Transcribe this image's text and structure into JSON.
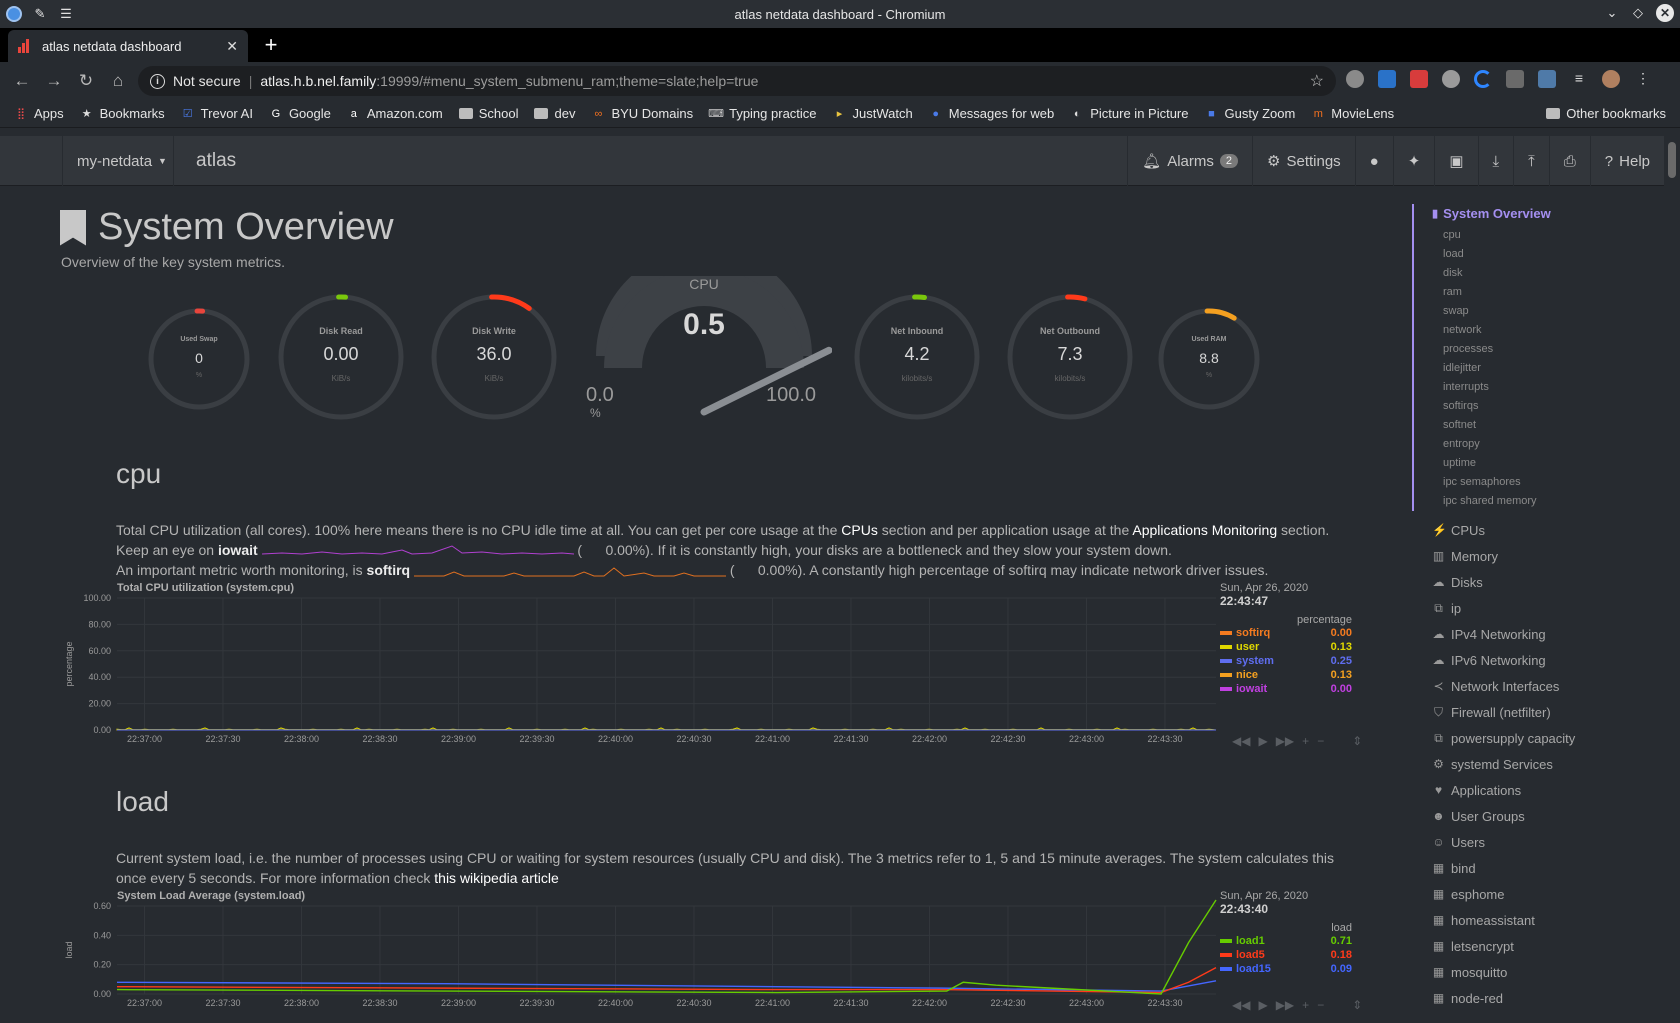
{
  "window": {
    "title": "atlas netdata dashboard - Chromium"
  },
  "tab": {
    "title": "atlas netdata dashboard"
  },
  "omnibox": {
    "security": "Not secure",
    "host": "atlas.h.b.nel.family",
    "path": ":19999/#menu_system_submenu_ram;theme=slate;help=true"
  },
  "bookmarks": [
    {
      "label": "Apps",
      "icon": "apps-grid-icon"
    },
    {
      "label": "Bookmarks",
      "icon": "star-icon"
    },
    {
      "label": "Trevor AI",
      "icon": "check-square-icon"
    },
    {
      "label": "Google",
      "icon": "google-icon"
    },
    {
      "label": "Amazon.com",
      "icon": "amazon-icon"
    },
    {
      "label": "School",
      "icon": "folder-icon"
    },
    {
      "label": "dev",
      "icon": "folder-icon"
    },
    {
      "label": "BYU Domains",
      "icon": "link-icon"
    },
    {
      "label": "Typing practice",
      "icon": "keyboard-icon"
    },
    {
      "label": "JustWatch",
      "icon": "play-icon"
    },
    {
      "label": "Messages for web",
      "icon": "chat-icon"
    },
    {
      "label": "Picture in Picture",
      "icon": "pip-icon"
    },
    {
      "label": "Gusty Zoom",
      "icon": "video-icon"
    },
    {
      "label": "MovieLens",
      "icon": "m-icon"
    }
  ],
  "other_bookmarks": "Other bookmarks",
  "nav": {
    "brand": "my-netdata",
    "host": "atlas",
    "alarms": "Alarms",
    "alarm_count": "2",
    "settings": "Settings",
    "help": "Help"
  },
  "overview": {
    "title": "System Overview",
    "subtitle": "Overview of the key system metrics."
  },
  "gauges": {
    "used_swap": {
      "label": "Used Swap",
      "value": "0",
      "unit": "%",
      "fraction": 0.0
    },
    "disk_read": {
      "label": "Disk Read",
      "value": "0.00",
      "unit": "KiB/s",
      "fraction": 0.0
    },
    "disk_write": {
      "label": "Disk Write",
      "value": "36.0",
      "unit": "KiB/s",
      "fraction": 0.1
    },
    "cpu": {
      "label": "CPU",
      "value": "0.5",
      "min": "0.0",
      "max": "100.0",
      "unit": "%",
      "fraction": 0.005
    },
    "net_inbound": {
      "label": "Net Inbound",
      "value": "4.2",
      "unit": "kilobits/s",
      "fraction": 0.02
    },
    "net_outbound": {
      "label": "Net Outbound",
      "value": "7.3",
      "unit": "kilobits/s",
      "fraction": 0.04
    },
    "used_ram": {
      "label": "Used RAM",
      "value": "8.8",
      "unit": "%",
      "fraction": 0.088
    }
  },
  "cpu_section": {
    "title": "cpu",
    "desc1_a": "Total CPU utilization (all cores). 100% here means there is no CPU idle time at all. You can get per core usage at the ",
    "desc1_link1": "CPUs",
    "desc1_b": " section and per application usage at the ",
    "desc1_link2": "Applications Monitoring",
    "desc1_c": " section.",
    "desc2_a": "Keep an eye on ",
    "desc2_bold": "iowait",
    "desc2_val": "0.00%",
    "desc2_b": ". If it is constantly high, your disks are a bottleneck and they slow your system down.",
    "desc3_a": "An important metric worth monitoring, is ",
    "desc3_bold": "softirq",
    "desc3_val": "0.00%",
    "desc3_b": ". A constantly high percentage of softirq may indicate network driver issues."
  },
  "load_section": {
    "title": "load",
    "desc_a": "Current system load, i.e. the number of processes using CPU or waiting for system resources (usually CPU and disk). The 3 metrics refer to 1, 5 and 15 minute averages. The system calculates this once every 5 seconds. For more information check ",
    "desc_link": "this wikipedia article"
  },
  "chart_data": [
    {
      "type": "area",
      "title": "Total CPU utilization (system.cpu)",
      "ylabel": "percentage",
      "ylim": [
        0,
        100
      ],
      "yticks": [
        "100.00",
        "80.00",
        "60.00",
        "40.00",
        "20.00",
        "0.00"
      ],
      "x": [
        "22:37:00",
        "22:37:30",
        "22:38:00",
        "22:38:30",
        "22:39:00",
        "22:39:30",
        "22:40:00",
        "22:40:30",
        "22:41:00",
        "22:41:30",
        "22:42:00",
        "22:42:30",
        "22:43:00",
        "22:43:30"
      ],
      "legend_date": "Sun, Apr 26, 2020",
      "legend_time": "22:43:47",
      "legend_units": "percentage",
      "series": [
        {
          "name": "softirq",
          "value": "0.00",
          "color": "#f47b20"
        },
        {
          "name": "user",
          "value": "0.13",
          "color": "#e0d800"
        },
        {
          "name": "system",
          "value": "0.25",
          "color": "#5f6ef0"
        },
        {
          "name": "nice",
          "value": "0.13",
          "color": "#f4a020"
        },
        {
          "name": "iowait",
          "value": "0.00",
          "color": "#c040e0"
        }
      ]
    },
    {
      "type": "line",
      "title": "System Load Average (system.load)",
      "ylabel": "load",
      "ylim": [
        0,
        0.6
      ],
      "yticks": [
        "0.60",
        "0.40",
        "0.20",
        "0.00"
      ],
      "x": [
        "22:37:00",
        "22:37:30",
        "22:38:00",
        "22:38:30",
        "22:39:00",
        "22:39:30",
        "22:40:00",
        "22:40:30",
        "22:41:00",
        "22:41:30",
        "22:42:00",
        "22:42:30",
        "22:43:00",
        "22:43:30"
      ],
      "legend_date": "Sun, Apr 26, 2020",
      "legend_time": "22:43:40",
      "legend_units": "load",
      "series": [
        {
          "name": "load1",
          "value": "0.71",
          "color": "#66cc00"
        },
        {
          "name": "load5",
          "value": "0.18",
          "color": "#ff3a1a"
        },
        {
          "name": "load15",
          "value": "0.09",
          "color": "#4466ff"
        }
      ]
    }
  ],
  "menu": {
    "active": "System Overview",
    "subitems": [
      "cpu",
      "load",
      "disk",
      "ram",
      "swap",
      "network",
      "processes",
      "idlejitter",
      "interrupts",
      "softirqs",
      "softnet",
      "entropy",
      "uptime",
      "ipc semaphores",
      "ipc shared memory"
    ],
    "items": [
      {
        "label": "CPUs",
        "icon": "bolt-icon",
        "glyph": "⚡"
      },
      {
        "label": "Memory",
        "icon": "memory-icon",
        "glyph": "▥"
      },
      {
        "label": "Disks",
        "icon": "hdd-icon",
        "glyph": "☁"
      },
      {
        "label": "ip",
        "icon": "sitemap-icon",
        "glyph": "⧉"
      },
      {
        "label": "IPv4 Networking",
        "icon": "cloud-icon",
        "glyph": "☁"
      },
      {
        "label": "IPv6 Networking",
        "icon": "cloud-icon",
        "glyph": "☁"
      },
      {
        "label": "Network Interfaces",
        "icon": "share-icon",
        "glyph": "≺"
      },
      {
        "label": "Firewall (netfilter)",
        "icon": "shield-icon",
        "glyph": "⛉"
      },
      {
        "label": "powersupply capacity",
        "icon": "sitemap-icon",
        "glyph": "⧉"
      },
      {
        "label": "systemd Services",
        "icon": "cogs-icon",
        "glyph": "⚙"
      },
      {
        "label": "Applications",
        "icon": "heartbeat-icon",
        "glyph": "♥"
      },
      {
        "label": "User Groups",
        "icon": "users-icon",
        "glyph": "☻"
      },
      {
        "label": "Users",
        "icon": "user-icon",
        "glyph": "☺"
      },
      {
        "label": "bind",
        "icon": "th-icon",
        "glyph": "▦"
      },
      {
        "label": "esphome",
        "icon": "th-icon",
        "glyph": "▦"
      },
      {
        "label": "homeassistant",
        "icon": "th-icon",
        "glyph": "▦"
      },
      {
        "label": "letsencrypt",
        "icon": "th-icon",
        "glyph": "▦"
      },
      {
        "label": "mosquitto",
        "icon": "th-icon",
        "glyph": "▦"
      },
      {
        "label": "node-red",
        "icon": "th-icon",
        "glyph": "▦"
      }
    ]
  },
  "colors": {
    "menu_active": "#a48ff0",
    "bg": "#272b30",
    "gauge_track": "#3a3e43"
  }
}
